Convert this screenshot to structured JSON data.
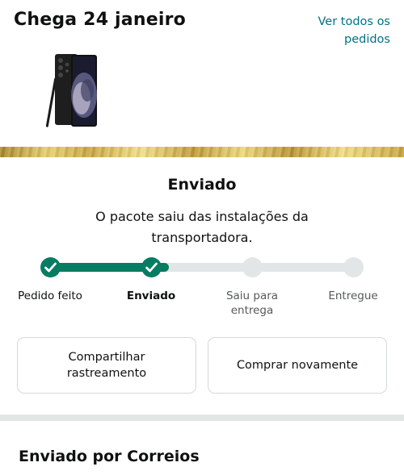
{
  "order": {
    "arrival_text": "Chega 24 janeiro",
    "view_orders_link": "Ver todos os pedidos",
    "product_icon": "smartphone-product-image"
  },
  "status": {
    "title": "Enviado",
    "description": "O pacote saiu das instalações da transportadora.",
    "progress_fraction": 0.39,
    "steps": [
      {
        "label": "Pedido feito",
        "state": "done"
      },
      {
        "label": "Enviado",
        "state": "current"
      },
      {
        "label": "Saiu para entrega",
        "state": "pending"
      },
      {
        "label": "Entregue",
        "state": "pending"
      }
    ]
  },
  "actions": {
    "share_tracking": "Compartilhar rastreamento",
    "buy_again": "Comprar novamente"
  },
  "shipping": {
    "carrier_heading": "Enviado por Correios"
  },
  "colors": {
    "accent_green": "#067d62",
    "link": "#007185",
    "track_gray": "#e3e6e6"
  }
}
